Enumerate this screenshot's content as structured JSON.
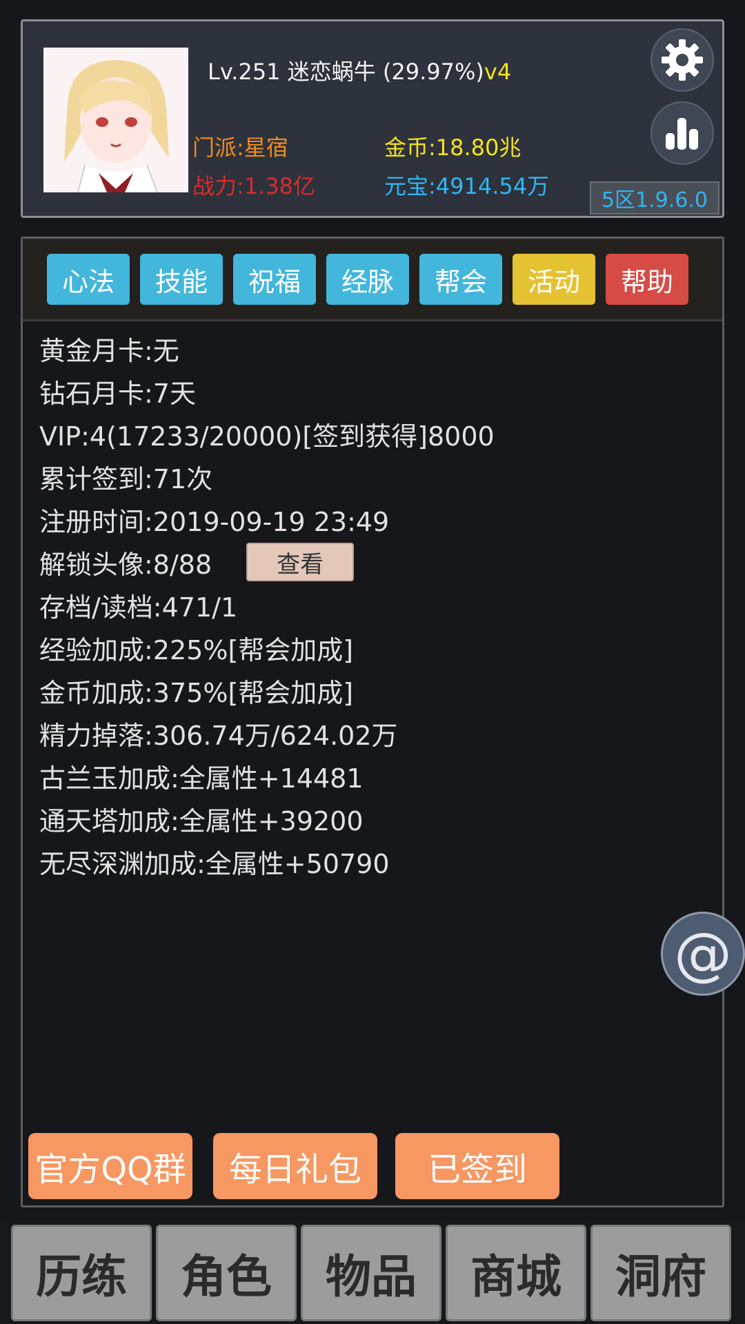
{
  "header": {
    "level": "Lv.251",
    "name": "迷恋蜗牛",
    "exp_percent": "(29.97%)",
    "vip_tag": "v4",
    "sect": "门派:星宿",
    "power": "战力:1.38亿",
    "gold": "金币:18.80兆",
    "yuanbao": "元宝:4914.54万",
    "server": "5区1.9.6.0"
  },
  "tabs": [
    {
      "label": "心法",
      "color": "#43b6dc"
    },
    {
      "label": "技能",
      "color": "#43b6dc"
    },
    {
      "label": "祝福",
      "color": "#43b6dc"
    },
    {
      "label": "经脉",
      "color": "#43b6dc"
    },
    {
      "label": "帮会",
      "color": "#43b6dc"
    },
    {
      "label": "活动",
      "color": "#e5c232"
    },
    {
      "label": "帮助",
      "color": "#d74b46"
    }
  ],
  "info": [
    "黄金月卡:无",
    "钻石月卡:7天",
    "VIP:4(17233/20000)[签到获得]8000",
    "累计签到:71次",
    "注册时间:2019-09-19 23:49",
    "解锁头像:8/88",
    "存档/读档:471/1",
    "经验加成:225%[帮会加成]",
    "金币加成:375%[帮会加成]",
    "精力掉落:306.74万/624.02万",
    "古兰玉加成:全属性+14481",
    "通天塔加成:全属性+39200",
    "无尽深渊加成:全属性+50790"
  ],
  "view_button": "查看",
  "actions": [
    "官方QQ群",
    "每日礼包",
    "已签到"
  ],
  "float_button": "@",
  "nav": [
    "历练",
    "角色",
    "物品",
    "商城",
    "洞府"
  ],
  "icons": {
    "settings": "gear-icon",
    "ranking": "bar-chart-icon",
    "mention": "at-icon"
  }
}
